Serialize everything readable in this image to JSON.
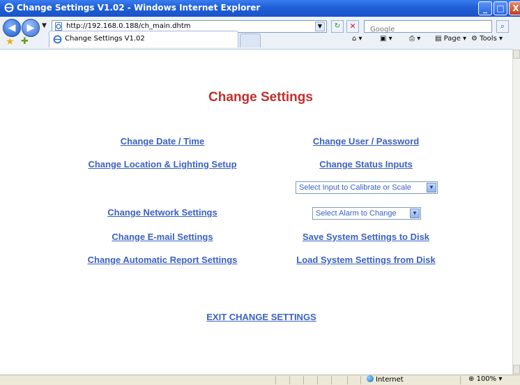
{
  "window": {
    "title": "Change Settings V1.02 - Windows Internet Explorer",
    "minimize_glyph": "_",
    "maximize_glyph": "□",
    "close_glyph": "X"
  },
  "addressbar": {
    "url": "http://192.168.0.188/ch_main.dhtm",
    "refresh_glyph": "↻",
    "stop_glyph": "✕"
  },
  "search": {
    "placeholder": "Google",
    "button_glyph": "⌕"
  },
  "tab": {
    "label": "Change Settings V1.02"
  },
  "command_bar": {
    "home_label": "▾",
    "feeds_label": "▾",
    "print_label": "▾",
    "page_label": "Page ▾",
    "tools_label": "Tools ▾"
  },
  "page": {
    "heading": "Change Settings",
    "links": {
      "date_time": "Change Date / Time",
      "user_password": "Change User / Password",
      "location_lighting": "Change Location & Lighting Setup",
      "status_inputs": "Change Status Inputs",
      "network": "Change Network Settings",
      "email": "Change E-mail Settings",
      "save_disk": "Save System Settings to Disk",
      "auto_report": "Change Automatic Report Settings",
      "load_disk": "Load System Settings from Disk",
      "exit": "EXIT CHANGE SETTINGS"
    },
    "selects": {
      "calibrate": "Select Input to Calibrate or Scale",
      "alarm": "Select Alarm to Change"
    }
  },
  "statusbar": {
    "zone": "Internet",
    "zoom": "100%"
  },
  "colors": {
    "heading": "#c0312e",
    "link": "#3b61c4",
    "titlebar": "#1f5fd6"
  }
}
